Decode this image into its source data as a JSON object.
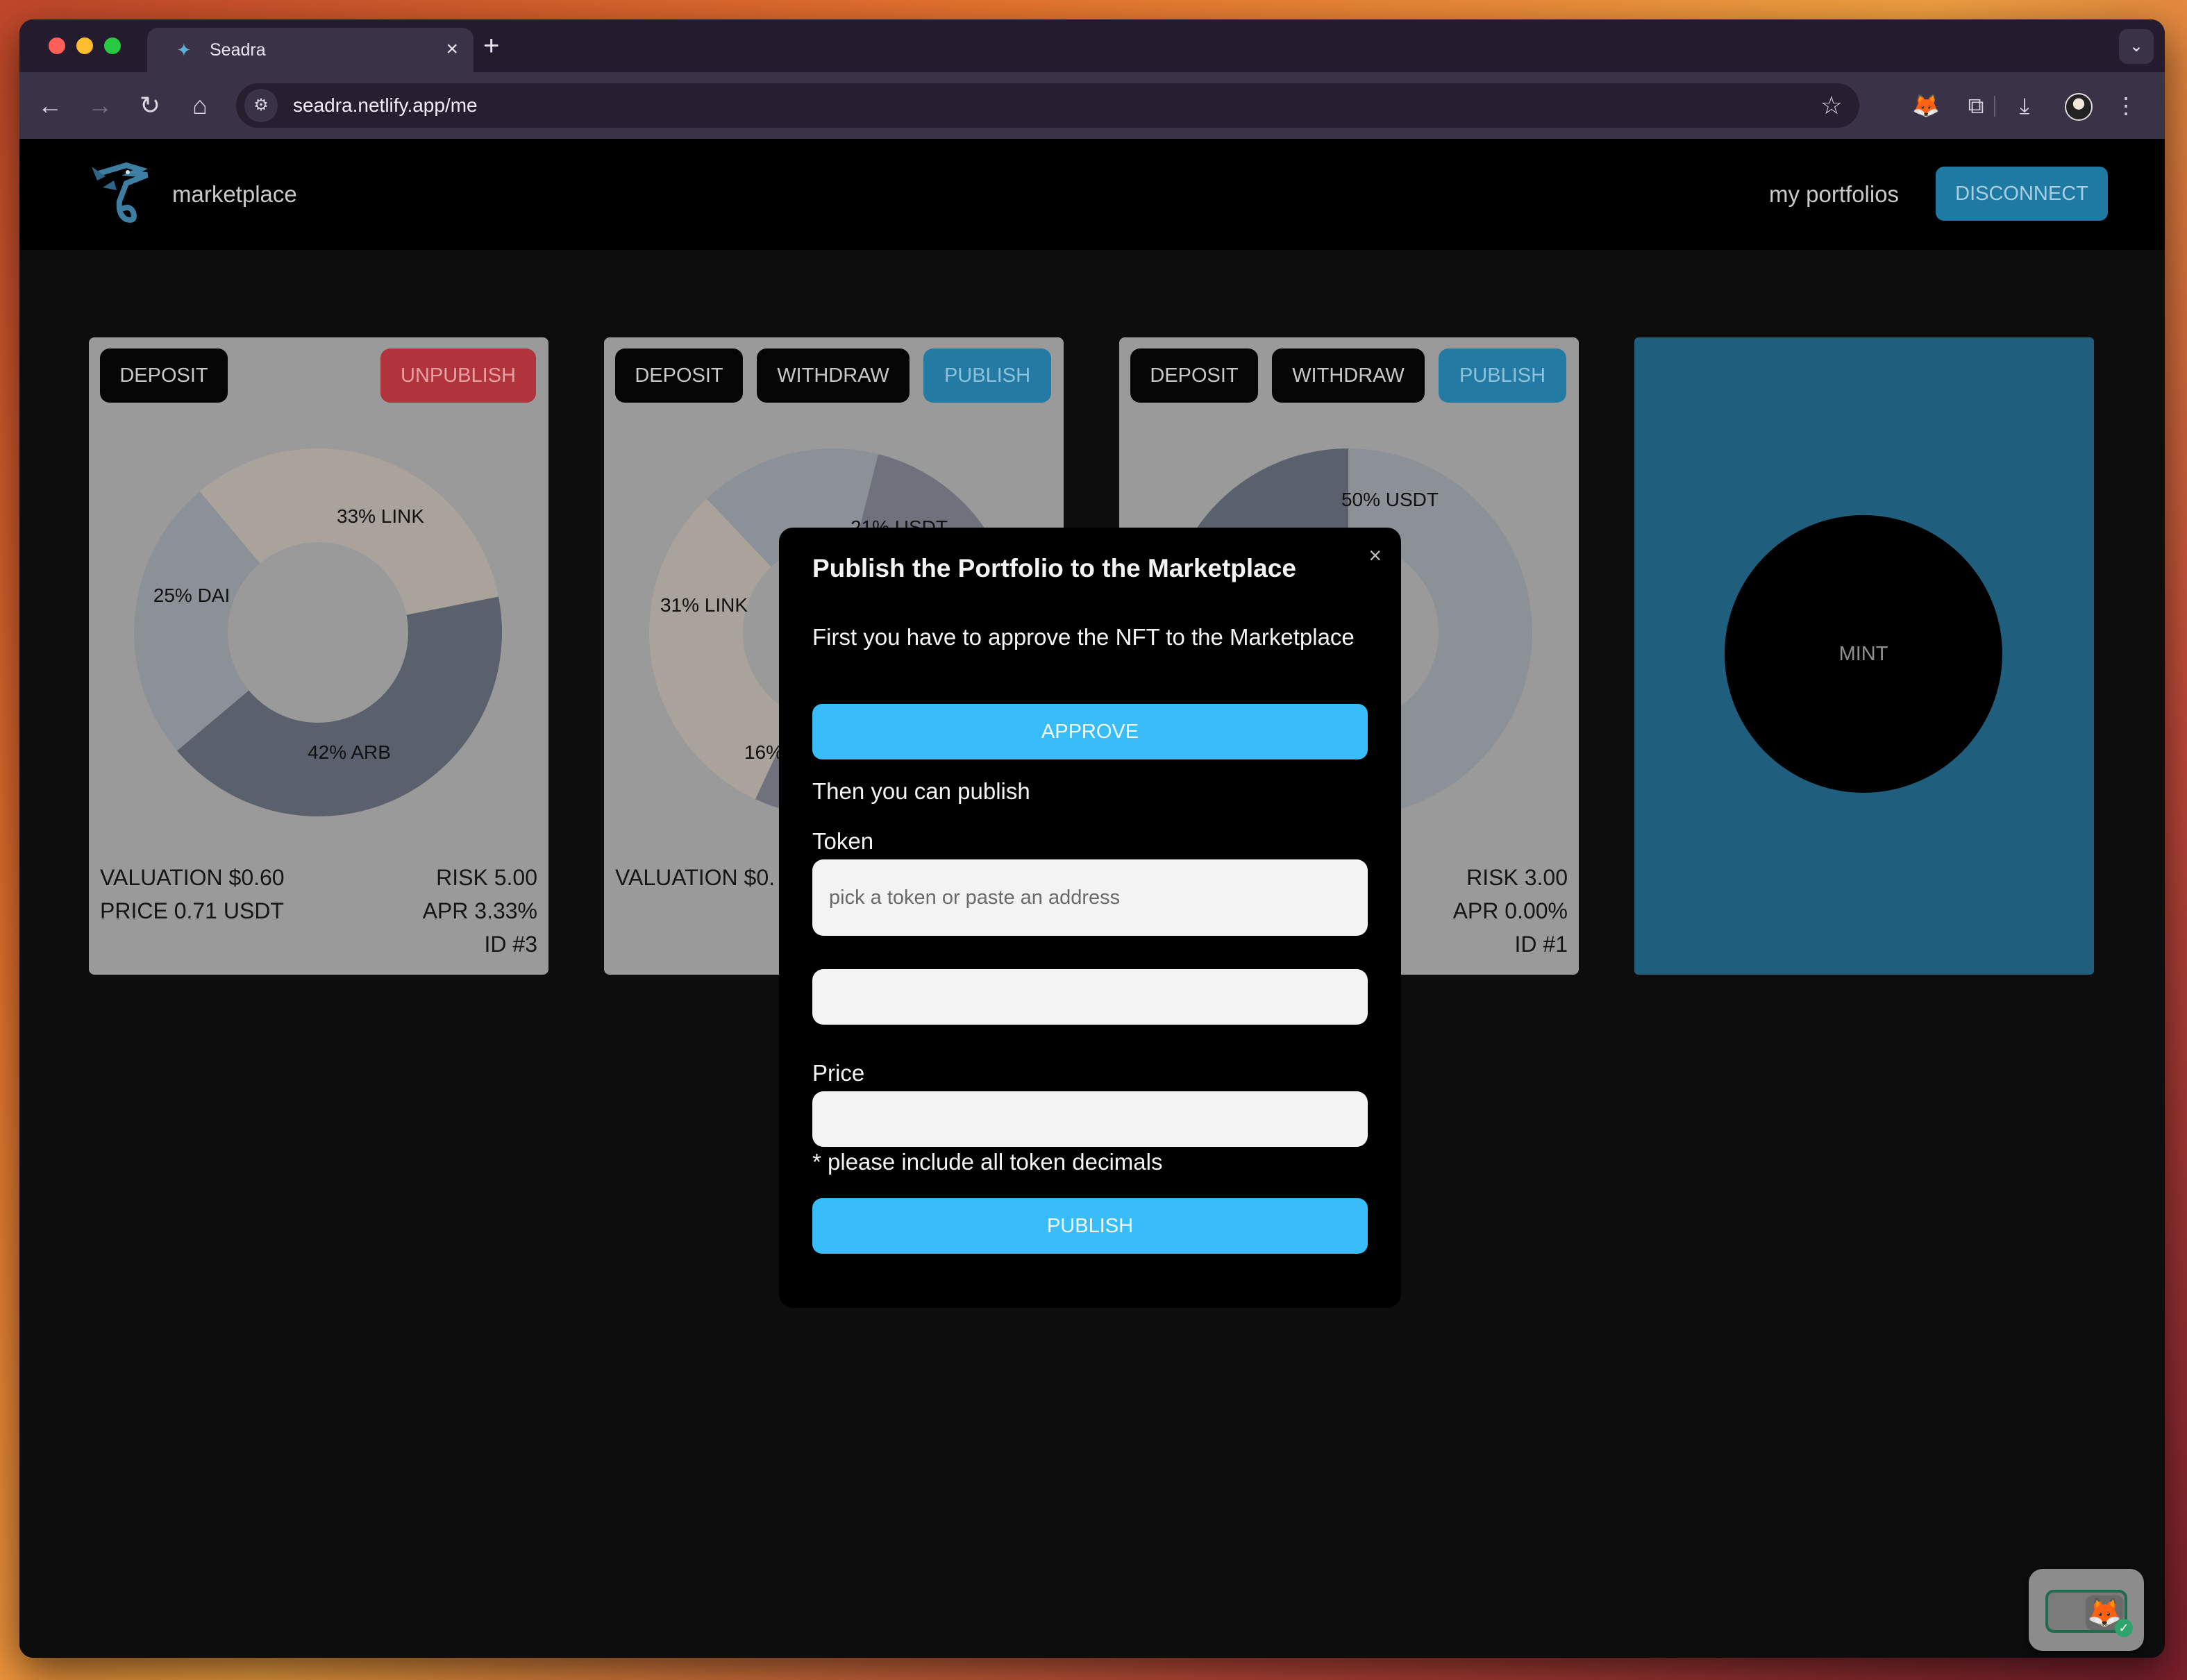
{
  "browser": {
    "tab_title": "Seadra",
    "url": "seadra.netlify.app/me",
    "new_tab_glyph": "+",
    "close_glyph": "×",
    "colors": {
      "traffic_red": "#ff5f57",
      "traffic_yellow": "#febc2e",
      "traffic_green": "#28c840"
    }
  },
  "header": {
    "brand": "marketplace",
    "nav_link": "my portfolios",
    "disconnect_label": "DISCONNECT"
  },
  "cards": [
    {
      "buttons": {
        "deposit": "DEPOSIT",
        "unpublish": "UNPUBLISH"
      },
      "chart_data": {
        "type": "pie",
        "labels": [
          "33% LINK",
          "42% ARB",
          "25% DAI"
        ],
        "values": [
          33,
          42,
          25
        ],
        "colors": [
          "#aaa39b",
          "#5a606c",
          "#8c9197"
        ]
      },
      "valuation": "VALUATION $0.60",
      "price": "PRICE 0.71 USDT",
      "risk": "RISK 5.00",
      "apr": "APR 3.33%",
      "id": "ID #3"
    },
    {
      "buttons": {
        "deposit": "DEPOSIT",
        "withdraw": "WITHDRAW",
        "publish": "PUBLISH"
      },
      "chart_data": {
        "type": "pie",
        "labels": [
          "31% LINK",
          "16%",
          "21% USDT"
        ],
        "values": [
          31,
          16,
          53
        ],
        "colors": [
          "#aaa39b",
          "#8c9197",
          "#6f727c"
        ]
      },
      "valuation": "VALUATION $0."
    },
    {
      "buttons": {
        "deposit": "DEPOSIT",
        "withdraw": "WITHDRAW",
        "publish": "PUBLISH"
      },
      "chart_data": {
        "type": "pie",
        "labels": [
          "50% USDT"
        ],
        "values": [
          50,
          50
        ],
        "colors": [
          "#8c9197",
          "#5a606c"
        ]
      },
      "risk": "RISK 3.00",
      "apr": "APR 0.00%",
      "id": "ID #1"
    }
  ],
  "mint_label": "MINT",
  "modal": {
    "title": "Publish the Portfolio to the Marketplace",
    "close": "×",
    "intro": "First you have to approve the NFT to the Marketplace",
    "approve_label": "APPROVE",
    "then_text": "Then you can publish",
    "token_label": "Token",
    "token_placeholder": "pick a token or paste an address",
    "amount_value": "",
    "price_label": "Price",
    "price_value": "",
    "note": "* please include all token decimals",
    "publish_label": "PUBLISH"
  }
}
